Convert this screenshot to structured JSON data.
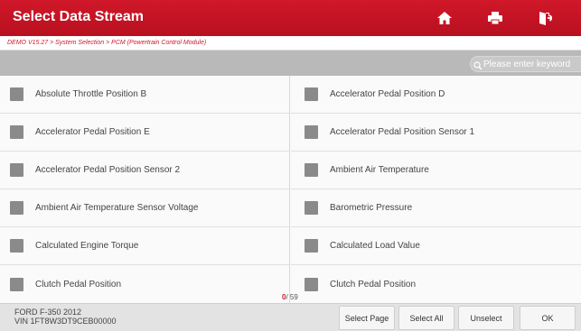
{
  "header": {
    "title": "Select Data Stream",
    "buttons": [
      {
        "name": "home-button",
        "icon": "home-icon"
      },
      {
        "name": "print-button",
        "icon": "printer-icon"
      },
      {
        "name": "exit-button",
        "icon": "exit-icon"
      }
    ],
    "colors": {
      "bar": "#c8141f",
      "text": "#ffffff"
    }
  },
  "breadcrumb": "DEMO V15.27 > System Selection > PCM (Powertrain Control Module)",
  "search": {
    "placeholder": "Please enter keyword"
  },
  "list": {
    "left": [
      "Absolute Throttle Position B",
      "Accelerator Pedal Position E",
      "Accelerator Pedal Position Sensor 2",
      "Ambient Air Temperature Sensor Voltage",
      "Calculated Engine Torque",
      "Clutch Pedal Position"
    ],
    "right": [
      "Accelerator Pedal Position D",
      "Accelerator Pedal Position Sensor 1",
      "Ambient Air Temperature",
      "Barometric Pressure",
      "Calculated Load Value",
      "Clutch Pedal Position"
    ]
  },
  "counter": {
    "selected": "0",
    "total": "/ 59"
  },
  "footer": {
    "vehicle_line1": "FORD F-350 2012",
    "vehicle_line2": "VIN 1FT8W3DT9CEB00000",
    "buttons": [
      "Select Page",
      "Select All",
      "Unselect",
      "OK"
    ]
  }
}
